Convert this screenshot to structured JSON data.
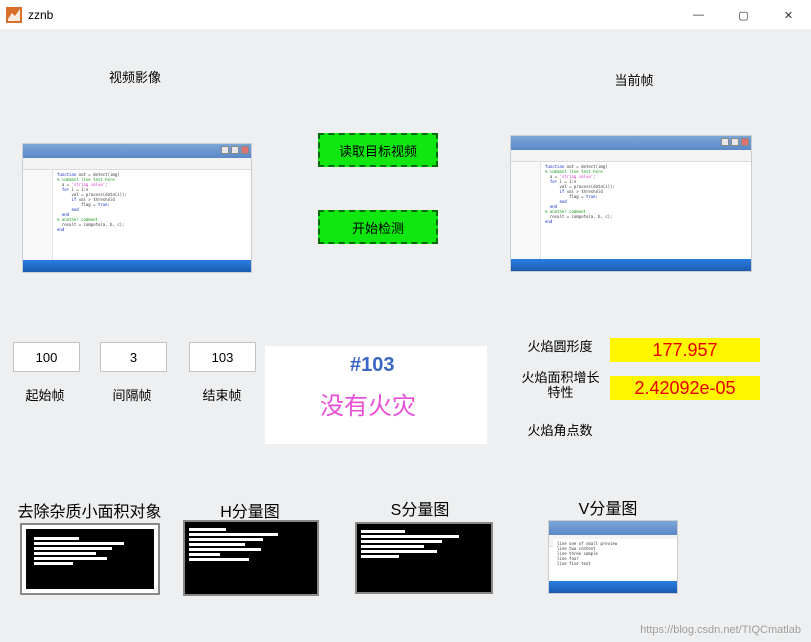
{
  "window": {
    "title": "zznb",
    "min": "—",
    "max": "▢",
    "close": "✕"
  },
  "watermark": "https://blog.csdn.net/TIQCmatlab",
  "labels": {
    "video": "视频影像",
    "current_frame": "当前帧",
    "start_frame": "起始帧",
    "interval_frame": "间隔帧",
    "end_frame": "结束帧",
    "remove_small": "去除杂质小面积对象",
    "h_map": "H分量图",
    "s_map": "S分量图",
    "v_map": "V分量图",
    "circularity": "火焰圆形度",
    "area_growth": "火焰面积增长特性",
    "corners": "火焰角点数"
  },
  "buttons": {
    "read_video": "读取目标视频",
    "start_detect": "开始检测"
  },
  "inputs": {
    "start": "100",
    "interval": "3",
    "end": "103"
  },
  "status": {
    "frame_id": "#103",
    "result": "没有火灾"
  },
  "metrics": {
    "circularity": "177.957",
    "area_growth": "2.42092e-05"
  }
}
